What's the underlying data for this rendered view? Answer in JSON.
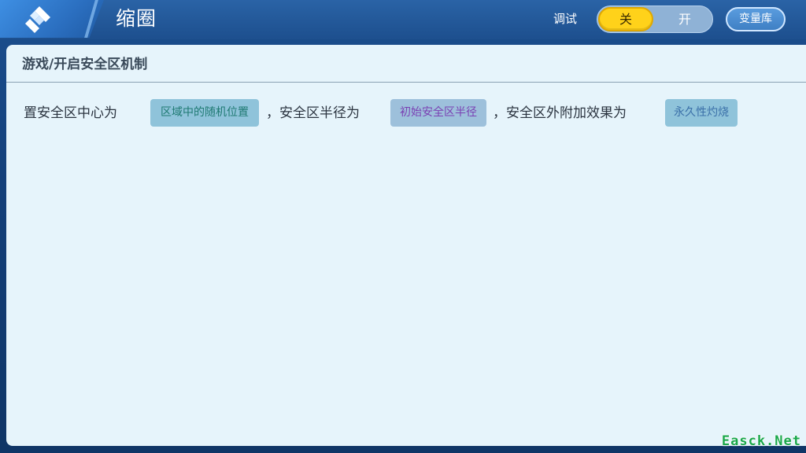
{
  "header": {
    "title": "缩圈",
    "debug_label": "调试",
    "toggle": {
      "off_label": "关",
      "on_label": "开",
      "selected": "关"
    },
    "variables_button": "变量库"
  },
  "panel": {
    "breadcrumb": "游戏/开启安全区机制",
    "rule": {
      "text_1": "置安全区中心为",
      "param_1": "区域中的随机位置",
      "text_2": "，安全区半径为",
      "param_2": "初始安全区半径",
      "text_3": "，安全区外附加效果为",
      "param_3": "永久性灼烧"
    }
  },
  "watermark": "Easck.Net",
  "colors": {
    "header_bg": "#1d4f8e",
    "panel_bg": "#e6f4fb",
    "toggle_active": "#ffd21a",
    "chip_bg": "#8fc3da",
    "watermark": "#1aa84a"
  },
  "icons": {
    "back": "diamond-back-icon"
  }
}
